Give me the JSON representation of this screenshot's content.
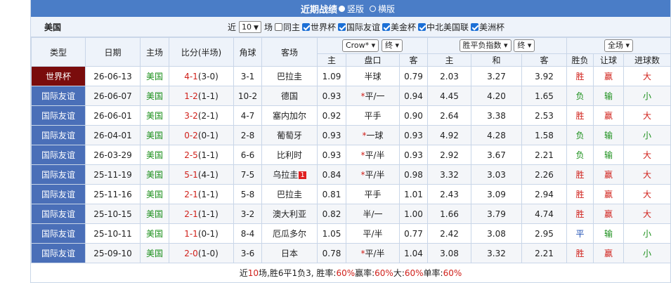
{
  "header": {
    "title": "近期战绩",
    "opt_vertical": "竖版",
    "opt_horizontal": "横版"
  },
  "filter": {
    "team": "美国",
    "recent_label": "近",
    "recent_value": "10",
    "games_label": "场",
    "same_host": "同主",
    "leagues": [
      "世界杯",
      "国际友谊",
      "美金杯",
      "中北美国联",
      "美洲杯"
    ]
  },
  "columns": {
    "type": "类型",
    "date": "日期",
    "home": "主场",
    "score": "比分(半场)",
    "corner": "角球",
    "away": "客场",
    "company": "Crow*",
    "final1": "终",
    "result_sel": "胜平负指数",
    "final2": "终",
    "range": "全场",
    "wl": "胜负",
    "handicap_res": "让球",
    "goals": "进球数"
  },
  "subcolumns": {
    "h": "主",
    "line": "盘口",
    "a": "客",
    "h2": "主",
    "d": "和",
    "a2": "客"
  },
  "matches": [
    {
      "type": "世界杯",
      "date": "26-06-13",
      "home": "美国",
      "score": "4-1",
      "half": "(3-0)",
      "corner": "3-1",
      "away": "巴拉圭",
      "badge": "",
      "h": "1.09",
      "line": "半球",
      "star": "",
      "a": "0.79",
      "w": "2.03",
      "d": "3.27",
      "l": "3.92",
      "wl": "胜",
      "hr": "赢",
      "g": "大"
    },
    {
      "type": "国际友谊",
      "date": "26-06-07",
      "home": "美国",
      "score": "1-2",
      "half": "(1-1)",
      "corner": "10-2",
      "away": "德国",
      "badge": "",
      "h": "0.93",
      "line": "平/一",
      "star": "*",
      "a": "0.94",
      "w": "4.45",
      "d": "4.20",
      "l": "1.65",
      "wl": "负",
      "hr": "输",
      "g": "小"
    },
    {
      "type": "国际友谊",
      "date": "26-06-01",
      "home": "美国",
      "score": "3-2",
      "half": "(2-1)",
      "corner": "4-7",
      "away": "塞内加尔",
      "badge": "",
      "h": "0.92",
      "line": "平手",
      "star": "",
      "a": "0.90",
      "w": "2.64",
      "d": "3.38",
      "l": "2.53",
      "wl": "胜",
      "hr": "赢",
      "g": "大"
    },
    {
      "type": "国际友谊",
      "date": "26-04-01",
      "home": "美国",
      "score": "0-2",
      "half": "(0-1)",
      "corner": "2-8",
      "away": "葡萄牙",
      "badge": "",
      "h": "0.93",
      "line": "一球",
      "star": "*",
      "a": "0.93",
      "w": "4.92",
      "d": "4.28",
      "l": "1.58",
      "wl": "负",
      "hr": "输",
      "g": "小"
    },
    {
      "type": "国际友谊",
      "date": "26-03-29",
      "home": "美国",
      "score": "2-5",
      "half": "(1-1)",
      "corner": "6-6",
      "away": "比利时",
      "badge": "",
      "h": "0.93",
      "line": "平/半",
      "star": "*",
      "a": "0.93",
      "w": "2.92",
      "d": "3.67",
      "l": "2.21",
      "wl": "负",
      "hr": "输",
      "g": "大"
    },
    {
      "type": "国际友谊",
      "date": "25-11-19",
      "home": "美国",
      "score": "5-1",
      "half": "(4-1)",
      "corner": "7-5",
      "away": "乌拉圭",
      "badge": "1",
      "h": "0.84",
      "line": "平/半",
      "star": "*",
      "a": "0.98",
      "w": "3.32",
      "d": "3.03",
      "l": "2.26",
      "wl": "胜",
      "hr": "赢",
      "g": "大"
    },
    {
      "type": "国际友谊",
      "date": "25-11-16",
      "home": "美国",
      "score": "2-1",
      "half": "(1-1)",
      "corner": "5-8",
      "away": "巴拉圭",
      "badge": "",
      "h": "0.81",
      "line": "平手",
      "star": "",
      "a": "1.01",
      "w": "2.43",
      "d": "3.09",
      "l": "2.94",
      "wl": "胜",
      "hr": "赢",
      "g": "大"
    },
    {
      "type": "国际友谊",
      "date": "25-10-15",
      "home": "美国",
      "score": "2-1",
      "half": "(1-1)",
      "corner": "3-2",
      "away": "澳大利亚",
      "badge": "",
      "h": "0.82",
      "line": "半/一",
      "star": "",
      "a": "1.00",
      "w": "1.66",
      "d": "3.79",
      "l": "4.74",
      "wl": "胜",
      "hr": "赢",
      "g": "大"
    },
    {
      "type": "国际友谊",
      "date": "25-10-11",
      "home": "美国",
      "score": "1-1",
      "half": "(0-1)",
      "corner": "8-4",
      "away": "厄瓜多尔",
      "badge": "",
      "h": "1.05",
      "line": "平/半",
      "star": "",
      "a": "0.77",
      "w": "2.42",
      "d": "3.08",
      "l": "2.95",
      "wl": "平",
      "hr": "输",
      "g": "小"
    },
    {
      "type": "国际友谊",
      "date": "25-09-10",
      "home": "美国",
      "score": "2-0",
      "half": "(1-0)",
      "corner": "3-6",
      "away": "日本",
      "badge": "",
      "h": "0.78",
      "line": "平/半",
      "star": "*",
      "a": "1.04",
      "w": "3.08",
      "d": "3.32",
      "l": "2.21",
      "wl": "胜",
      "hr": "赢",
      "g": "小"
    }
  ],
  "summary": {
    "p1": "近",
    "n": "10",
    "p2": "场,胜6平1负3, 胜率:",
    "win": "60%",
    "p3": " 赢率:",
    "ying": "60%",
    "p4": " 大:",
    "big": "60%",
    "p5": " 单率:",
    "odd": "60%"
  }
}
